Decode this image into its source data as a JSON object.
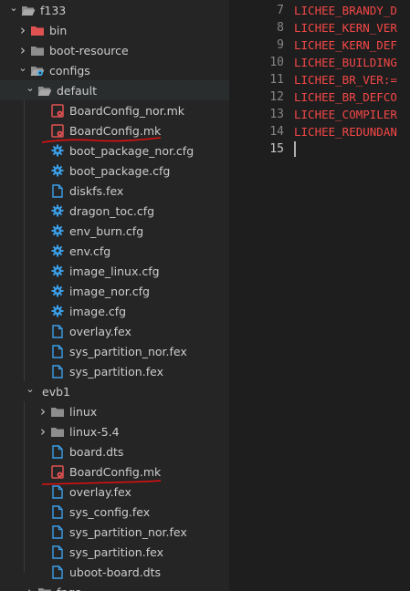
{
  "tree": [
    {
      "label": "f133",
      "type": "folder-open",
      "depth": 0,
      "chev": "down"
    },
    {
      "label": "bin",
      "type": "folder-red",
      "depth": 1,
      "chev": "right"
    },
    {
      "label": "boot-resource",
      "type": "folder",
      "depth": 1,
      "chev": "right"
    },
    {
      "label": "configs",
      "type": "folder-config-open",
      "depth": 1,
      "chev": "down"
    },
    {
      "label": "default",
      "type": "folder-open",
      "depth": 2,
      "chev": "down",
      "selected": true
    },
    {
      "label": "BoardConfig_nor.mk",
      "type": "mk",
      "depth": 3
    },
    {
      "label": "BoardConfig.mk",
      "type": "mk",
      "depth": 3
    },
    {
      "label": "boot_package_nor.cfg",
      "type": "cfg",
      "depth": 3
    },
    {
      "label": "boot_package.cfg",
      "type": "cfg",
      "depth": 3
    },
    {
      "label": "diskfs.fex",
      "type": "file",
      "depth": 3
    },
    {
      "label": "dragon_toc.cfg",
      "type": "cfg",
      "depth": 3
    },
    {
      "label": "env_burn.cfg",
      "type": "cfg",
      "depth": 3
    },
    {
      "label": "env.cfg",
      "type": "cfg",
      "depth": 3
    },
    {
      "label": "image_linux.cfg",
      "type": "cfg",
      "depth": 3
    },
    {
      "label": "image_nor.cfg",
      "type": "cfg",
      "depth": 3
    },
    {
      "label": "image.cfg",
      "type": "cfg",
      "depth": 3
    },
    {
      "label": "overlay.fex",
      "type": "file",
      "depth": 3
    },
    {
      "label": "sys_partition_nor.fex",
      "type": "file",
      "depth": 3
    },
    {
      "label": "sys_partition.fex",
      "type": "file",
      "depth": 3
    },
    {
      "label": "evb1",
      "type": "none",
      "depth": 2,
      "chev": "down"
    },
    {
      "label": "linux",
      "type": "folder",
      "depth": 3,
      "chev": "right",
      "badge": "↳"
    },
    {
      "label": "linux-5.4",
      "type": "folder",
      "depth": 3,
      "chev": "right"
    },
    {
      "label": "board.dts",
      "type": "file",
      "depth": 3,
      "badge": "↳"
    },
    {
      "label": "BoardConfig.mk",
      "type": "mk",
      "depth": 3
    },
    {
      "label": "overlay.fex",
      "type": "file",
      "depth": 3
    },
    {
      "label": "sys_config.fex",
      "type": "file",
      "depth": 3
    },
    {
      "label": "sys_partition_nor.fex",
      "type": "file",
      "depth": 3
    },
    {
      "label": "sys_partition.fex",
      "type": "file",
      "depth": 3
    },
    {
      "label": "uboot-board.dts",
      "type": "file",
      "depth": 3
    },
    {
      "label": "fpga",
      "type": "folder",
      "depth": 2,
      "chev": "right"
    }
  ],
  "editor": {
    "lines": [
      {
        "num": "7",
        "text": "LICHEE_BRANDY_D"
      },
      {
        "num": "8",
        "text": "LICHEE_KERN_VER"
      },
      {
        "num": "9",
        "text": "LICHEE_KERN_DEF"
      },
      {
        "num": "10",
        "text": "LICHEE_BUILDING"
      },
      {
        "num": "11",
        "text": "LICHEE_BR_VER:="
      },
      {
        "num": "12",
        "text": "LICHEE_BR_DEFCO"
      },
      {
        "num": "13",
        "text": "LICHEE_COMPILER"
      },
      {
        "num": "14",
        "text": "LICHEE_REDUNDAN"
      },
      {
        "num": "15",
        "text": ""
      }
    ],
    "active_line": "15"
  },
  "colors": {
    "folder": "#8d8d8d",
    "folder_red": "#e05252",
    "config_accent": "#3ba4e0",
    "mk_red": "#e05252",
    "file_blue": "#3b9fe8",
    "gear_blue": "#3b9fe8",
    "annotation_red": "#e01010"
  }
}
